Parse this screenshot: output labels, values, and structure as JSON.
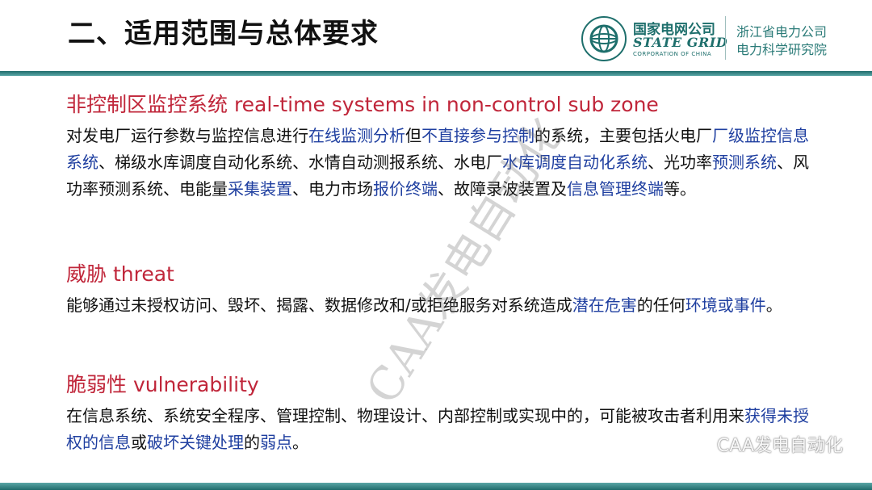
{
  "slide": {
    "title": "二、适用范围与总体要求"
  },
  "logo": {
    "brand_cn": "国家电网公司",
    "brand_en": "STATE GRID",
    "brand_sub": "CORPORATION OF CHINA",
    "institute_line1": "浙江省电力公司",
    "institute_line2": "电力科学研究院"
  },
  "sections": [
    {
      "heading": "非控制区监控系统 real-time systems in non-control sub zone",
      "segments": [
        {
          "t": "对发电厂运行参数与监控信息进行",
          "hl": false
        },
        {
          "t": "在线监测分析",
          "hl": true
        },
        {
          "t": "但",
          "hl": false
        },
        {
          "t": "不直接参与控制",
          "hl": true
        },
        {
          "t": "的系统，主要包括火电厂",
          "hl": false
        },
        {
          "t": "厂级监控信息系统",
          "hl": true
        },
        {
          "t": "、梯级水库调度自动化系统、水情自动测报系统、水电厂",
          "hl": false
        },
        {
          "t": "水库调度自动化系统",
          "hl": true
        },
        {
          "t": "、光功率",
          "hl": false
        },
        {
          "t": "预测系统",
          "hl": true
        },
        {
          "t": "、风功率预测系统、电能量",
          "hl": false
        },
        {
          "t": "采集装置",
          "hl": true
        },
        {
          "t": "、电力市场",
          "hl": false
        },
        {
          "t": "报价终端",
          "hl": true
        },
        {
          "t": "、故障录波装置及",
          "hl": false
        },
        {
          "t": "信息管理终端",
          "hl": true
        },
        {
          "t": "等。",
          "hl": false
        }
      ]
    },
    {
      "heading": "威胁 threat",
      "segments": [
        {
          "t": "能够通过未授权访问、毁坏、揭露、数据修改和/或拒绝服务对系统造成",
          "hl": false
        },
        {
          "t": "潜在危害",
          "hl": true
        },
        {
          "t": "的任何",
          "hl": false
        },
        {
          "t": "环境或事件",
          "hl": true
        },
        {
          "t": "。",
          "hl": false
        }
      ]
    },
    {
      "heading": "脆弱性 vulnerability",
      "segments": [
        {
          "t": "在信息系统、系统安全程序、管理控制、物理设计、内部控制或实现中的，可能被攻击者利用来",
          "hl": false
        },
        {
          "t": "获得未授权的信息",
          "hl": true
        },
        {
          "t": "或",
          "hl": false
        },
        {
          "t": "破坏关键处理",
          "hl": true
        },
        {
          "t": "的",
          "hl": false
        },
        {
          "t": "弱点",
          "hl": true
        },
        {
          "t": "。",
          "hl": false
        }
      ]
    }
  ],
  "watermark": {
    "text": "CAA发电自动化",
    "wechat_label": "CAA发电自动化"
  },
  "colors": {
    "heading": "#c0263a",
    "highlight": "#1f3fa0",
    "brand": "#1e6f6c"
  }
}
